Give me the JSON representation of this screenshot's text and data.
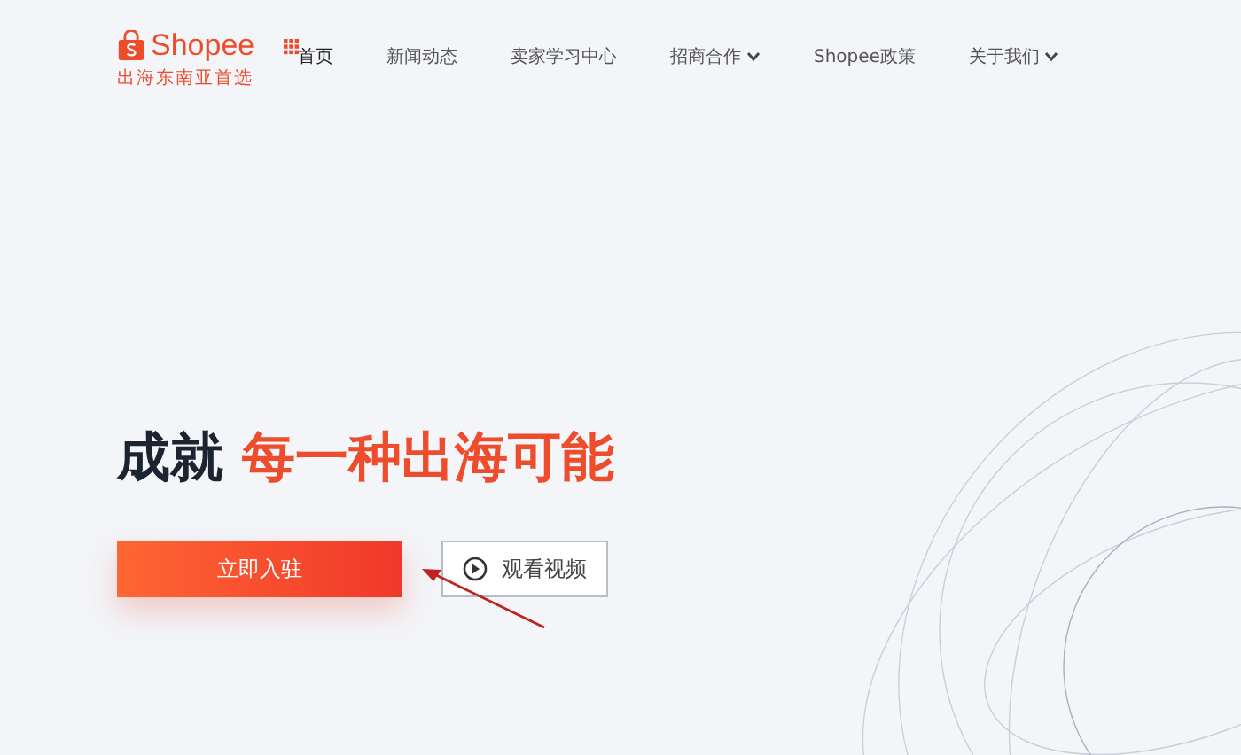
{
  "logo": {
    "name": "Shopee",
    "tagline": "出海东南亚首选"
  },
  "nav": [
    {
      "label": "首页",
      "selected": true,
      "has_menu": false
    },
    {
      "label": "新闻动态",
      "selected": false,
      "has_menu": false
    },
    {
      "label": "卖家学习中心",
      "selected": false,
      "has_menu": false
    },
    {
      "label": "招商合作",
      "selected": false,
      "has_menu": true
    },
    {
      "label": "Shopee政策",
      "selected": false,
      "has_menu": false
    },
    {
      "label": "关于我们",
      "selected": false,
      "has_menu": true
    }
  ],
  "hero": {
    "headline": "成就",
    "headline_highlight": "每一种出海可能",
    "primary_button": "立即入驻",
    "video_button": "观看视频"
  }
}
